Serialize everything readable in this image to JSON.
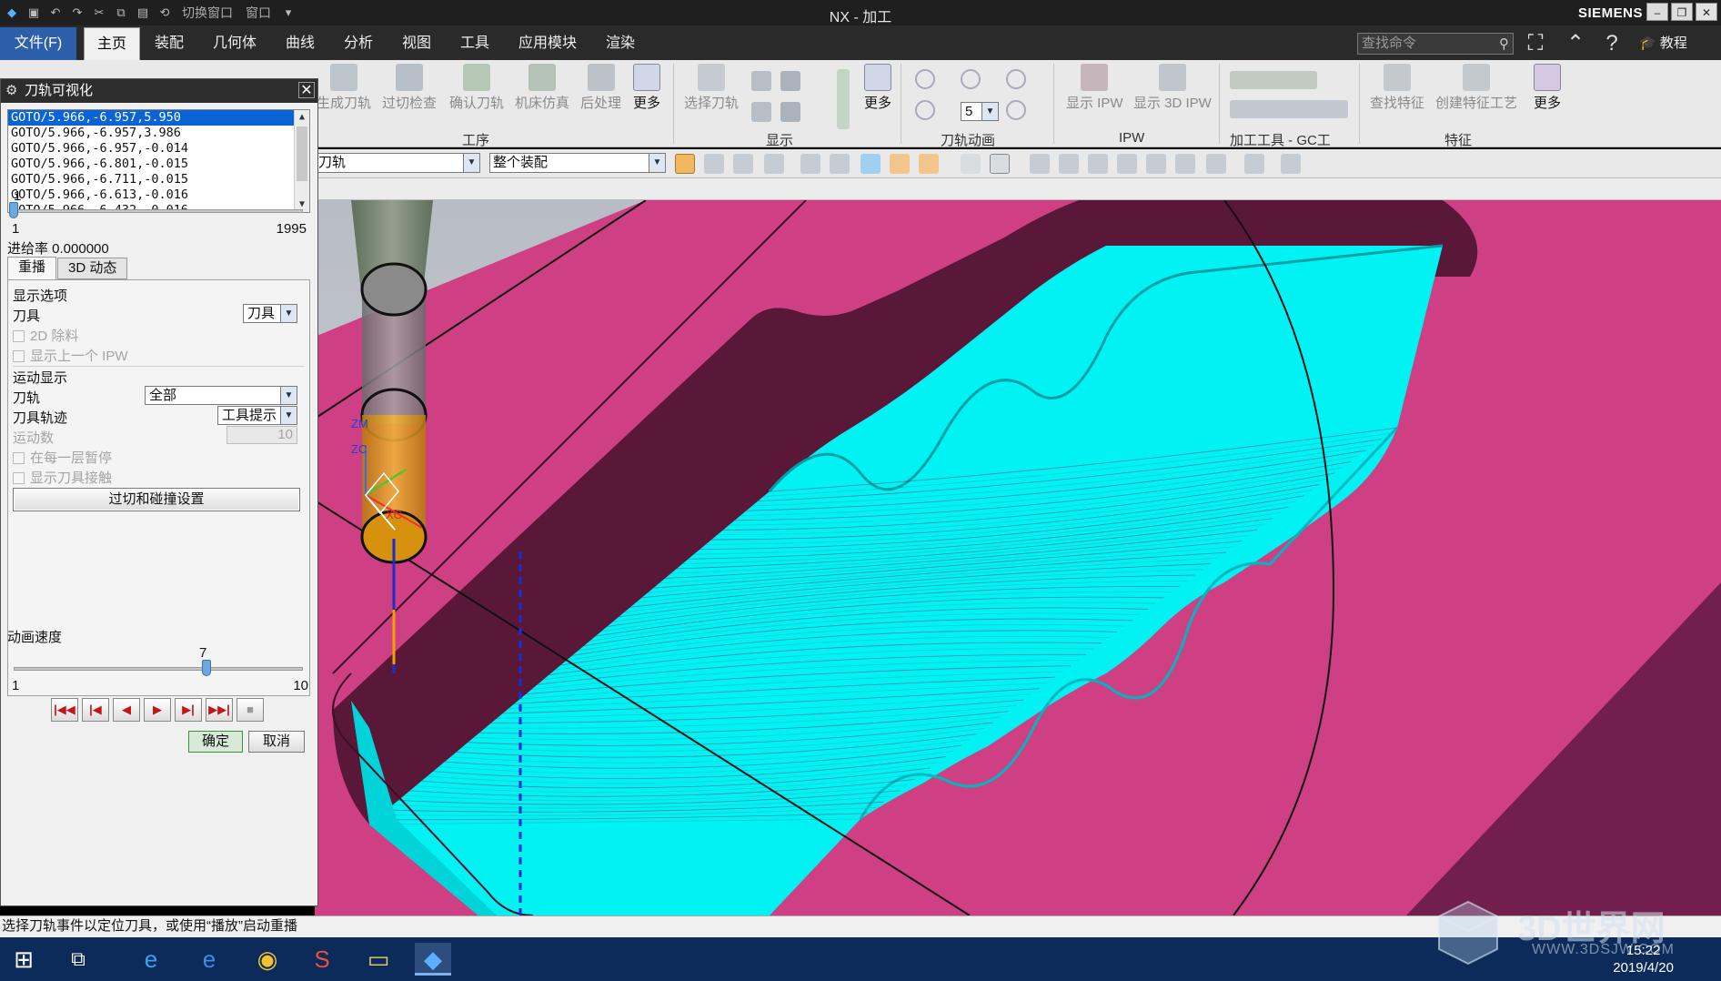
{
  "titlebar": {
    "app_title": "NX - 加工",
    "brand": "SIEMENS",
    "switch_window": "切换窗口",
    "window_menu": "窗口"
  },
  "ribbon_tabs": {
    "file": "文件(F)",
    "items": [
      "主页",
      "装配",
      "几何体",
      "曲线",
      "分析",
      "视图",
      "工具",
      "应用模块",
      "渲染"
    ],
    "search_placeholder": "查找命令",
    "tutorial": "教程"
  },
  "ribbon": {
    "buttons": {
      "generate": "生成刀轨",
      "gouge_check": "过切检查",
      "verify": "确认刀轨",
      "machine_sim": "机床仿真",
      "postprocess": "后处理",
      "more1": "更多",
      "select_path": "选择刀轨",
      "more2": "更多",
      "show_ipw": "显示 IPW",
      "show_3d_ipw": "显示 3D IPW",
      "find_feature": "查找特征",
      "create_feature_process": "创建特征工艺",
      "more3": "更多"
    },
    "anim_speed_value": "5",
    "groups": [
      "工序",
      "显示",
      "刀轨动画",
      "IPW",
      "加工工具 - GC工",
      "特征"
    ]
  },
  "toolbar2": {
    "filter_type": "刀轨",
    "scope": "整个装配"
  },
  "dialog": {
    "title": "刀轨可视化",
    "events": [
      "GOTO/5.966,-6.957,5.950",
      "GOTO/5.966,-6.957,3.986",
      "GOTO/5.966,-6.957,-0.014",
      "GOTO/5.966,-6.801,-0.015",
      "GOTO/5.966,-6.711,-0.015",
      "GOTO/5.966,-6.613,-0.016",
      "GOTO/5.966,-6.432,-0.016"
    ],
    "event_slider": {
      "current": "1",
      "min": "1",
      "max": "1995",
      "position": 0.0
    },
    "feed_rate": "进给率 0.000000",
    "tabs": {
      "replay": "重播",
      "dynamic_3d": "3D 动态"
    },
    "display_options": {
      "header": "显示选项",
      "tool_label": "刀具",
      "tool_value": "刀具",
      "remove_2d": "2D 除料",
      "show_prev_ipw": "显示上一个 IPW"
    },
    "motion_display": {
      "header": "运动显示",
      "path_label": "刀轨",
      "path_value": "全部",
      "trace_label": "刀具轨迹",
      "trace_value": "工具提示",
      "motion_count_label": "运动数",
      "motion_count_value": "10",
      "pause_each_layer": "在每一层暂停",
      "show_tool_contact": "显示刀具接触"
    },
    "collision_button": "过切和碰撞设置",
    "anim_speed": {
      "label": "动画速度",
      "value": "7",
      "min": "1",
      "max": "10",
      "position": 0.6667
    },
    "ok": "确定",
    "cancel": "取消"
  },
  "status": "选择刀轨事件以定位刀具，或使用“播放”启动重播",
  "viewport": {
    "axis_labels": [
      "ZM",
      "ZC",
      "XC"
    ],
    "colors": {
      "background": "#c2c6cc",
      "part_top": "#cf3f84",
      "part_side": "#721f4d",
      "pocket_wall": "#5a1838",
      "toolpath": "#00f2f2",
      "tool_holder": "#7d8a77",
      "tool_body": "#e6a31d"
    }
  },
  "taskbar": {
    "time": "15:22",
    "date": "2019/4/20"
  },
  "watermark": {
    "title": "3D世界网",
    "url": "WWW.3DSJW.COM"
  }
}
